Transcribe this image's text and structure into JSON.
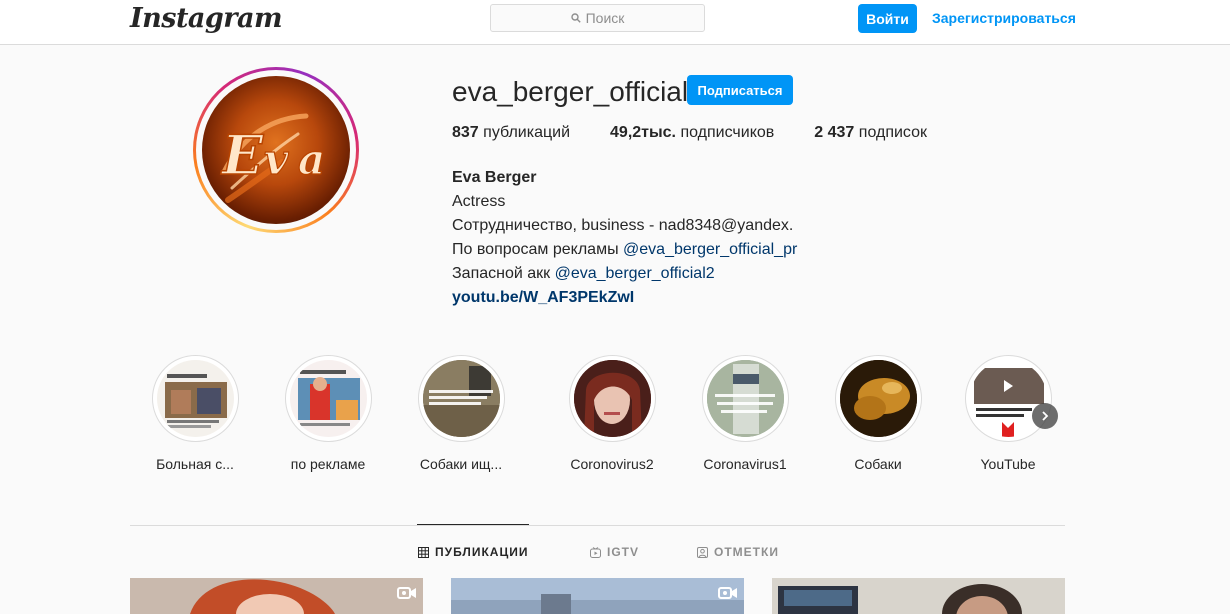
{
  "nav": {
    "logo": "Instagram",
    "search_placeholder": "Поиск",
    "login_label": "Войти",
    "signup_label": "Зарегистрироваться"
  },
  "profile": {
    "username": "eva_berger_official",
    "follow_label": "Подписаться",
    "avatar_icon": "eva-logo-avatar",
    "stats": {
      "posts_count": "837",
      "posts_label": "публикаций",
      "followers_count": "49,2тыс.",
      "followers_label": "подписчиков",
      "following_count": "2 437",
      "following_label": "подписок"
    },
    "bio": {
      "name": "Eva Berger",
      "category": "Actress",
      "line1": "Сотрудничество, business - nad8348@yandex.",
      "line2_prefix": "По вопросам рекламы ",
      "line2_link": "@eva_berger_official_pr",
      "line3_prefix": "Запасной акк ",
      "line3_link": "@eva_berger_official2",
      "url": "youtu.be/W_AF3PEkZwI"
    }
  },
  "highlights": [
    {
      "label": "Больная с..."
    },
    {
      "label": "по рекламе"
    },
    {
      "label": "Собаки ищ..."
    },
    {
      "label": "Coronovirus2"
    },
    {
      "label": "Coronavirus1"
    },
    {
      "label": "Собаки"
    },
    {
      "label": "YouTube"
    }
  ],
  "tabs": [
    {
      "label": "ПУБЛИКАЦИИ",
      "icon": "grid-icon",
      "active": true
    },
    {
      "label": "IGTV",
      "icon": "igtv-icon",
      "active": false
    },
    {
      "label": "ОТМЕТКИ",
      "icon": "tagged-icon",
      "active": false
    }
  ],
  "colors": {
    "accent": "#0095f6",
    "link": "#00376b",
    "text": "#262626",
    "muted": "#8e8e8e",
    "border": "#dbdbdb",
    "background": "#fafafa"
  }
}
